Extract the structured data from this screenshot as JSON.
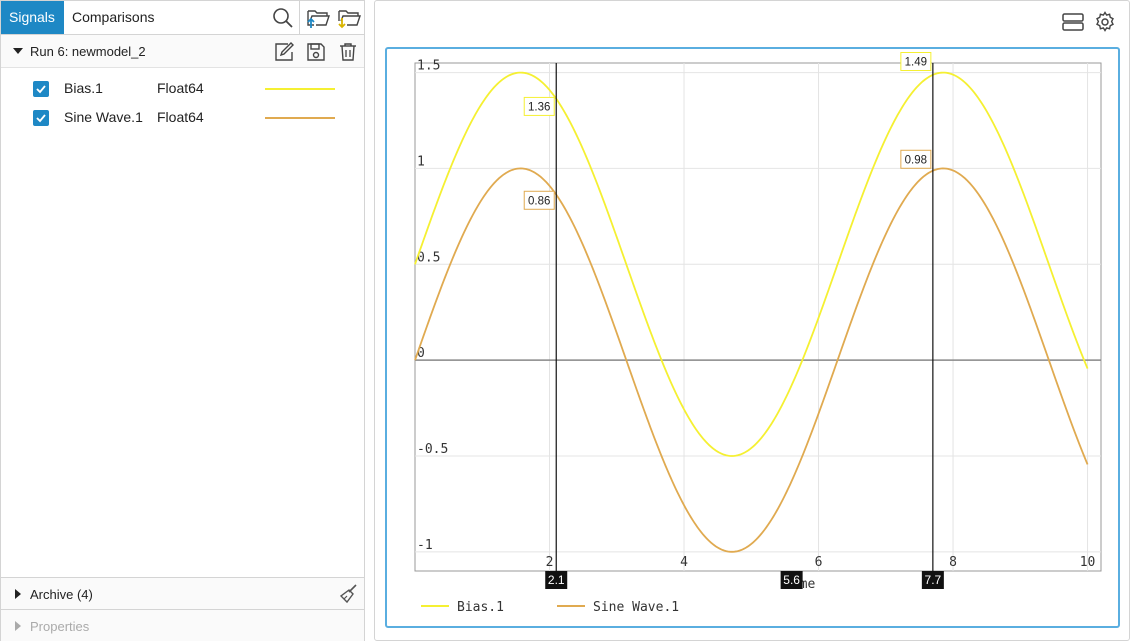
{
  "tabs": {
    "signals": "Signals",
    "comparisons": "Comparisons"
  },
  "toolbar_icons": [
    "search-icon",
    "folder-open-upload-icon",
    "folder-open-download-icon"
  ],
  "run": {
    "label": "Run 6: newmodel_2",
    "icons": [
      "rename-icon",
      "save-icon",
      "delete-icon"
    ]
  },
  "signals": [
    {
      "name": "Bias.1",
      "type": "Float64",
      "color": "#f5f032",
      "checked": true
    },
    {
      "name": "Sine Wave.1",
      "type": "Float64",
      "color": "#e0aa50",
      "checked": true
    }
  ],
  "archive": {
    "label": "Archive (4)",
    "icon": "broom-icon"
  },
  "properties": {
    "label": "Properties"
  },
  "plot_toolbar_icons": [
    "layout-icon",
    "settings-icon"
  ],
  "colors": {
    "accent": "#1e88c5",
    "plot_border": "#5aaee0",
    "bias": "#f5f032",
    "sine": "#e0aa50",
    "cursor_label_bg": "#111111"
  },
  "chart_data": {
    "type": "line",
    "xlabel": "Time",
    "ylabel": "",
    "xlim": [
      0,
      10.2
    ],
    "ylim": [
      -1.1,
      1.55
    ],
    "xticks": [
      2,
      4,
      6,
      8,
      10
    ],
    "yticks": [
      1.5,
      1,
      0.5,
      0,
      -0.5,
      -1
    ],
    "xtick_labels": [
      "2",
      "4",
      "6",
      "8",
      "10"
    ],
    "ytick_labels": [
      "1.5",
      "1",
      "0.5",
      "0",
      "-0.5",
      "-1"
    ],
    "grid": true,
    "legend_position": "bottom-left",
    "series": [
      {
        "name": "Bias.1",
        "color": "#f5f032",
        "function": "sin(t)+0.5",
        "x_start": 0,
        "x_end": 10,
        "y_start": 0.5,
        "y_end": -0.04
      },
      {
        "name": "Sine Wave.1",
        "color": "#e0aa50",
        "function": "sin(t)",
        "x_start": 0,
        "x_end": 10,
        "y_start": 0,
        "y_end": -0.54
      }
    ],
    "cursors": [
      {
        "x": 2.1,
        "label": "2.1",
        "values": [
          {
            "series": "Bias.1",
            "y": 1.36,
            "label": "1.36"
          },
          {
            "series": "Sine Wave.1",
            "y": 0.86,
            "label": "0.86"
          }
        ]
      },
      {
        "x": 7.7,
        "label": "7.7",
        "values": [
          {
            "series": "Bias.1",
            "y": 1.49,
            "label": "1.49"
          },
          {
            "series": "Sine Wave.1",
            "y": 0.98,
            "label": "0.98"
          }
        ]
      }
    ],
    "marker": {
      "x": 5.6,
      "label": "5.6"
    }
  }
}
